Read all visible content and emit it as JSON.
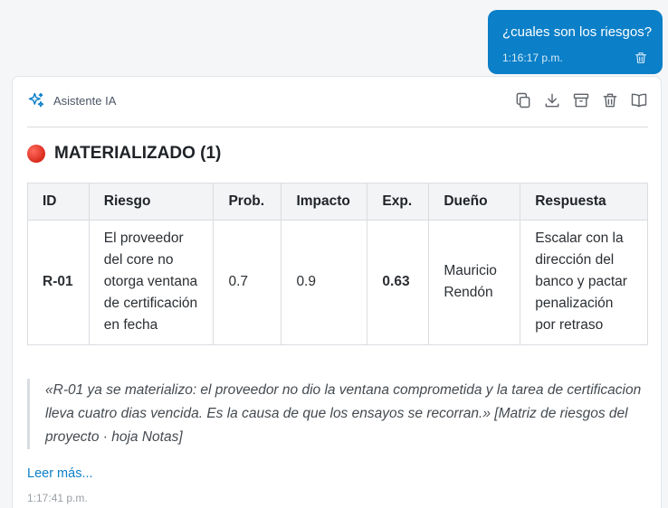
{
  "user_message": {
    "text": "¿cuales son los riesgos?",
    "time": "1:16:17 p.m."
  },
  "assistant": {
    "name": "Asistente IA",
    "time": "1:17:41 p.m.",
    "actions": [
      "copy-icon",
      "download-icon",
      "archive-icon",
      "trash-icon",
      "book-icon"
    ],
    "section_title": "MATERIALIZADO (1)",
    "status_color": "#d92a1c",
    "table": {
      "headers": [
        "ID",
        "Riesgo",
        "Prob.",
        "Impacto",
        "Exp.",
        "Dueño",
        "Respuesta"
      ],
      "rows": [
        [
          "R-01",
          "El proveedor del core no otorga ventana de certificación en fecha",
          "0.7",
          "0.9",
          "0.63",
          "Mauricio Rendón",
          "Escalar con la dirección del banco y pactar penalización por retraso"
        ]
      ]
    },
    "quote_text": "«R-01 ya se materializo: el proveedor no dio la ventana comprometida y la tarea de certificacion lleva cuatro dias vencida. Es la causa de que los ensayos se recorran.»",
    "quote_source": "[Matriz de riesgos del proyecto · hoja Notas]",
    "read_more": "Leer más..."
  },
  "colors": {
    "accent": "#0b7fc8"
  }
}
